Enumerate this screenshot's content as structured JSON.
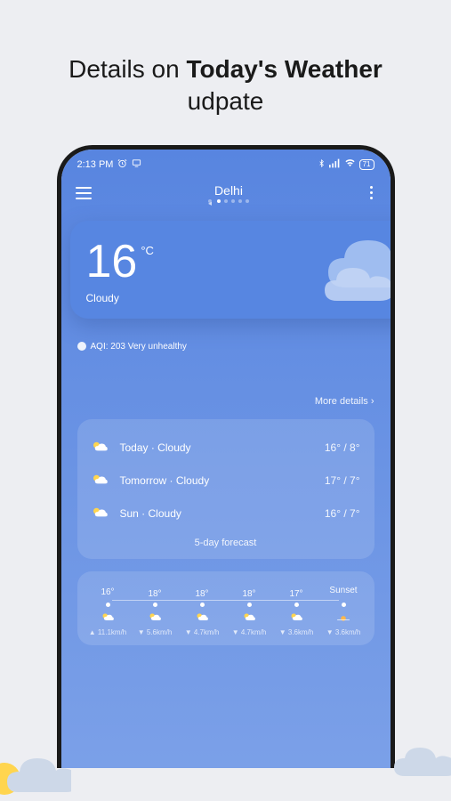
{
  "heading": {
    "prefix": "Details on ",
    "bold": "Today's Weather",
    "suffix": " udpate"
  },
  "status_bar": {
    "time": "2:13 PM",
    "battery": "71"
  },
  "header": {
    "location": "Delhi"
  },
  "hero": {
    "temp": "16",
    "unit": "°C",
    "condition": "Cloudy"
  },
  "aqi": {
    "text": "AQI: 203 Very unhealthy"
  },
  "more_details": "More details",
  "forecast": {
    "days": [
      {
        "label": "Today · Cloudy",
        "temps": "16° / 8°"
      },
      {
        "label": "Tomorrow · Cloudy",
        "temps": "17° / 7°"
      },
      {
        "label": "Sun · Cloudy",
        "temps": "16° / 7°"
      }
    ],
    "link": "5-day forecast"
  },
  "hourly": {
    "items": [
      {
        "temp": "16°",
        "wind": "11.1km/h",
        "arrow": "▲"
      },
      {
        "temp": "18°",
        "wind": "5.6km/h",
        "arrow": "▼"
      },
      {
        "temp": "18°",
        "wind": "4.7km/h",
        "arrow": "▼"
      },
      {
        "temp": "18°",
        "wind": "4.7km/h",
        "arrow": "▼"
      },
      {
        "temp": "17°",
        "wind": "3.6km/h",
        "arrow": "▼"
      },
      {
        "temp": "Sunset",
        "wind": "3.6km/h",
        "arrow": "▼"
      }
    ]
  }
}
